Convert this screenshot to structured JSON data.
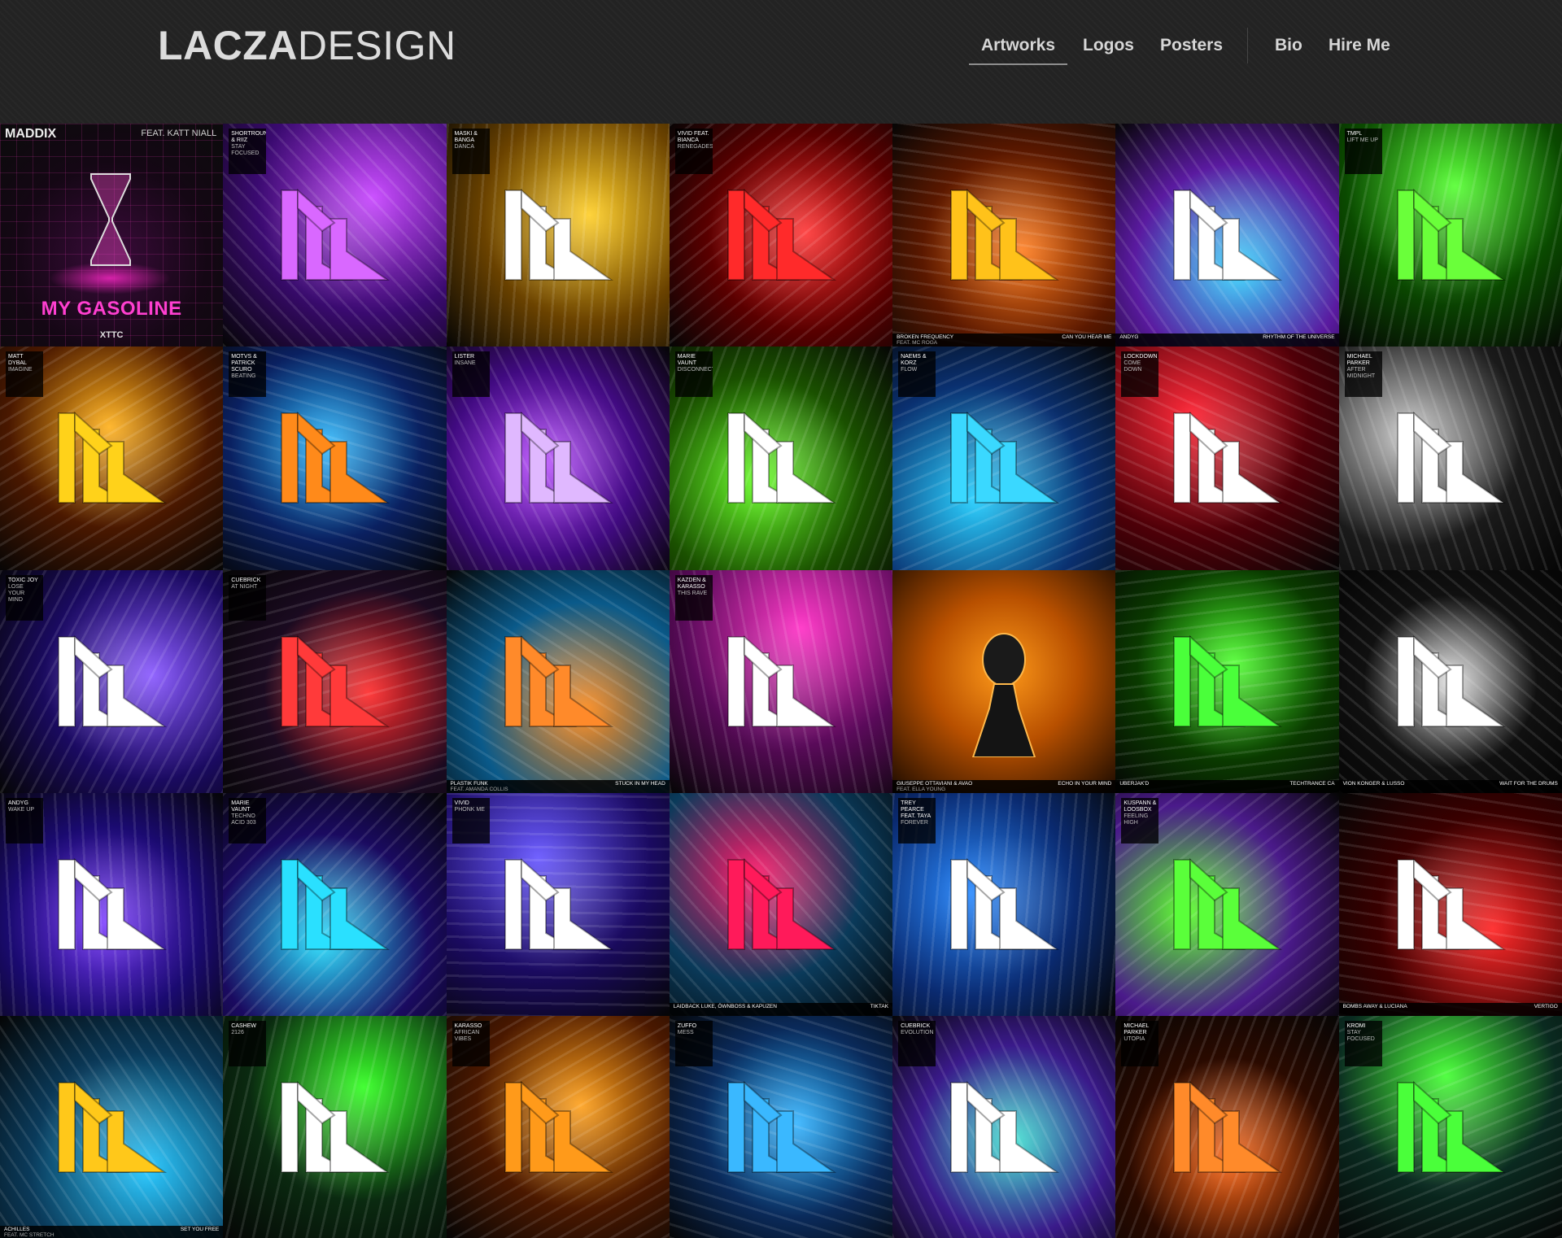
{
  "header": {
    "logo_bold": "LACZA",
    "logo_light": "DESIGN",
    "nav": [
      "Artworks",
      "Logos",
      "Posters",
      "Bio",
      "Hire Me"
    ],
    "active_nav": "Artworks"
  },
  "tiles": [
    {
      "theme": [
        "#ff2fd0",
        "#2a0030"
      ],
      "special": "maddix",
      "artist": "MADDIX",
      "feat": "FEAT. KATT NIALL",
      "title": "MY GASOLINE",
      "brand": "XTTC"
    },
    {
      "theme": [
        "#c94bff",
        "#3a0a70"
      ],
      "artist": "SHORTROUND & RIIZ",
      "sub": "STAY FOCUSED",
      "mark": "#d968ff"
    },
    {
      "theme": [
        "#ffcf2a",
        "#6a4200"
      ],
      "artist": "MASKI & BANGA",
      "sub": "DANCA",
      "mark": "#ffffff"
    },
    {
      "theme": [
        "#ff3030",
        "#5a0000"
      ],
      "artist": "VIVID FEAT. BIANCA",
      "sub": "RENEGADES",
      "mark": "#ff2a2a"
    },
    {
      "theme": [
        "#ff7a1a",
        "#5a1800"
      ],
      "mark": "#ffc21a",
      "footer_left": "BROKEN FREQUENCY",
      "footer_right": "CAN YOU HEAR ME",
      "footer_feat": "FEAT. MC ROGA"
    },
    {
      "theme": [
        "#3ad8ff",
        "#5a1aa0"
      ],
      "mark": "#ffffff",
      "footer_left": "ANDYG",
      "footer_right": "RHYTHM OF THE UNIVERSE"
    },
    {
      "theme": [
        "#5cff3a",
        "#0a4a00"
      ],
      "artist": "TMPL",
      "sub": "LIFT ME UP",
      "mark": "#6aff3a"
    },
    {
      "theme": [
        "#ffb01a",
        "#4a1800"
      ],
      "artist": "MATT DYBAL",
      "sub": "IMAGINE",
      "mark": "#ffd21a"
    },
    {
      "theme": [
        "#2ab8ff",
        "#0a2060"
      ],
      "artist": "MOTVS & PATRICK SCURO",
      "sub": "BEATING",
      "mark": "#ff8a1a"
    },
    {
      "theme": [
        "#b84bff",
        "#400a80"
      ],
      "artist": "LISTER",
      "sub": "INSANE",
      "mark": "#e0b8ff"
    },
    {
      "theme": [
        "#6aff2a",
        "#1a5000"
      ],
      "artist": "MARIE VAUNT",
      "sub": "DISCONNECT",
      "mark": "#ffffff"
    },
    {
      "theme": [
        "#2ad0ff",
        "#0a3070"
      ],
      "artist": "NAEMS & KORZ",
      "sub": "FLOW",
      "mark": "#3ad8ff"
    },
    {
      "theme": [
        "#ff2a3a",
        "#500008"
      ],
      "artist": "LOCKDOWN",
      "sub": "COME DOWN",
      "mark": "#ffffff"
    },
    {
      "theme": [
        "#d0d0d0",
        "#1a1a1a"
      ],
      "artist": "MICHAEL PARKER",
      "sub": "AFTER MIDNIGHT",
      "mark": "#ffffff"
    },
    {
      "theme": [
        "#8a5aff",
        "#1a0a60"
      ],
      "artist": "TOXIC JOY",
      "sub": "LOSE YOUR MIND",
      "mark": "#ffffff"
    },
    {
      "theme": [
        "#ff2a2a",
        "#1a0a20"
      ],
      "artist": "CUEBRICK",
      "sub": "AT NIGHT",
      "mark": "#ff3a3a"
    },
    {
      "theme": [
        "#ff8a1a",
        "#0a5a8a"
      ],
      "mark": "#ff8a2a",
      "footer_left": "PLASTIK FUNK",
      "footer_right": "STUCK IN MY HEAD",
      "footer_feat": "FEAT. AMANDA COLLIS"
    },
    {
      "theme": [
        "#ff3ac8",
        "#5a0a5a"
      ],
      "artist": "KAZDEN & KARASSO",
      "sub": "THIS RAVE",
      "mark": "#ffffff"
    },
    {
      "theme": [
        "#ff9a1a",
        "#1a0a00"
      ],
      "special": "figure",
      "footer_left": "GIUSEPPE OTTAVIANI & AVAO",
      "footer_right": "ECHO IN YOUR MIND",
      "footer_feat": "FEAT. ELLA YOUNG"
    },
    {
      "theme": [
        "#4aff2a",
        "#0a3a00"
      ],
      "mark": "#4aff3a",
      "footer_left": "UBERJAK'D",
      "footer_right": "TECHTRANCE CA"
    },
    {
      "theme": [
        "#e0e0e0",
        "#101010"
      ],
      "mark": "#ffffff",
      "footer_left": "VION KONGER & LUSSO",
      "footer_right": "WAIT FOR THE DRUMS"
    },
    {
      "theme": [
        "#7a3aff",
        "#1a0a70"
      ],
      "artist": "ANDYG",
      "sub": "WAKE UP",
      "mark": "#ffffff"
    },
    {
      "theme": [
        "#2ae0ff",
        "#1a0a60"
      ],
      "artist": "MARIE VAUNT",
      "sub": "TECHNO ACID 303",
      "mark": "#2ae0ff"
    },
    {
      "theme": [
        "#6a5aff",
        "#1a0a60"
      ],
      "artist": "VIVID",
      "sub": "PHONK ME",
      "mark": "#ffffff"
    },
    {
      "theme": [
        "#ff1a6a",
        "#0a3a5a"
      ],
      "mark": "#ff1a5a",
      "footer_left": "LAIDBACK LUKE, ÖWNBOSS & KAPUZEN",
      "footer_right": "TIKTAK"
    },
    {
      "theme": [
        "#2a8aff",
        "#0a2a70"
      ],
      "artist": "TREY PEARCE FEAT. TAYA",
      "sub": "FOREVER",
      "mark": "#ffffff"
    },
    {
      "theme": [
        "#5aff2a",
        "#4a1a8a"
      ],
      "artist": "KUSPANN & LOOSBOX",
      "sub": "FEELING HIGH",
      "mark": "#5aff3a"
    },
    {
      "theme": [
        "#ff2a2a",
        "#3a0000"
      ],
      "mark": "#ffffff",
      "footer_left": "BOMBS AWAY & LUCIANA",
      "footer_right": "VERTIGO"
    },
    {
      "theme": [
        "#2ac8ff",
        "#0a3a5a"
      ],
      "mark": "#ffc81a",
      "footer_left": "ACHILLES",
      "footer_right": "SET YOU FREE",
      "footer_feat": "FEAT. MC STRETCH"
    },
    {
      "theme": [
        "#3aff2a",
        "#0a2a10"
      ],
      "artist": "CASHEW",
      "sub": "2126",
      "mark": "#ffffff"
    },
    {
      "theme": [
        "#ffa01a",
        "#4a1800"
      ],
      "artist": "KARASSO",
      "sub": "AFRICAN VIBES",
      "mark": "#ff9a1a"
    },
    {
      "theme": [
        "#2ab0ff",
        "#0a2a5a"
      ],
      "artist": "ZUFFO",
      "sub": "MESS",
      "mark": "#3ab8ff"
    },
    {
      "theme": [
        "#3ae0d0",
        "#3a1a8a"
      ],
      "artist": "CUEBRICK",
      "sub": "EVOLUTION",
      "mark": "#ffffff"
    },
    {
      "theme": [
        "#ff6a1a",
        "#2a0a00"
      ],
      "artist": "MICHAEL PARKER",
      "sub": "UTOPIA",
      "mark": "#ff8a2a"
    },
    {
      "theme": [
        "#4aff3a",
        "#0a2a20"
      ],
      "artist": "KROMI",
      "sub": "STAY FOCUSED",
      "mark": "#4aff3a"
    }
  ]
}
